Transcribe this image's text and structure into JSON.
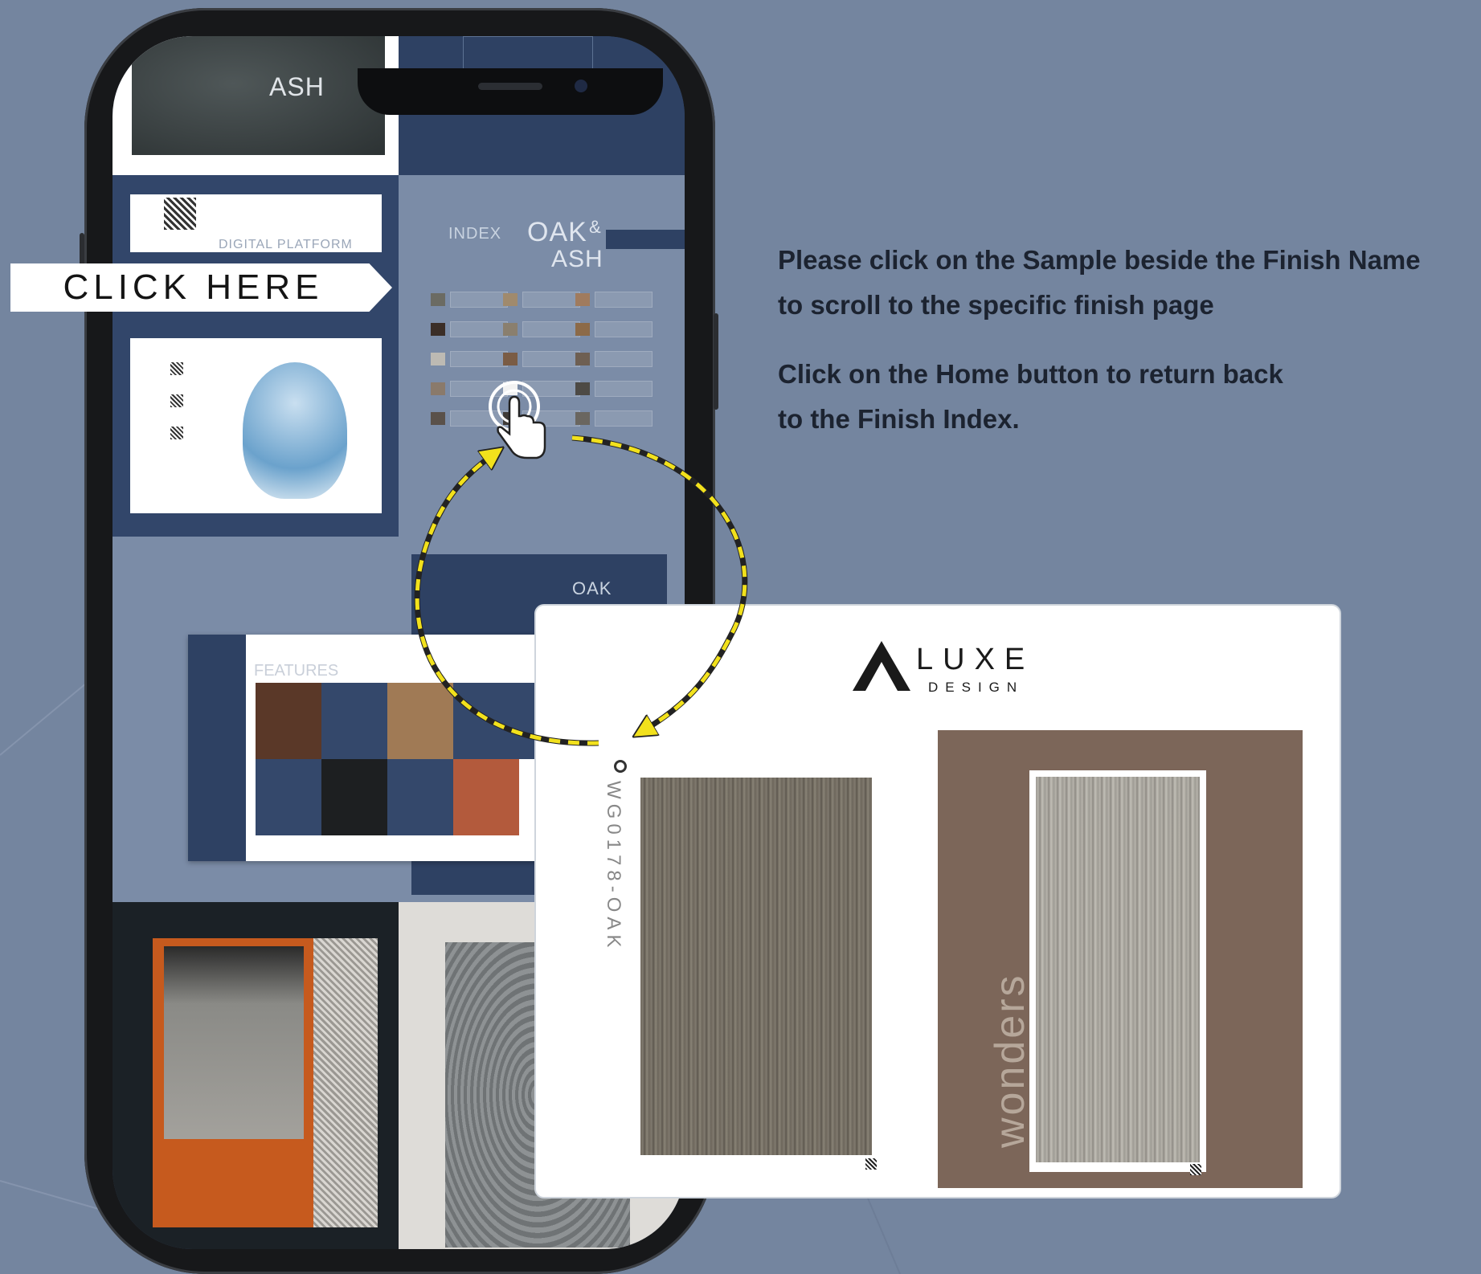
{
  "callout": {
    "label": "CLICK HERE"
  },
  "instructions": {
    "line1": "Please click on the Sample beside the Finish Name",
    "line2": "to scroll to the specific finish page",
    "line3": "Click on the Home button to return back",
    "line4": "to the Finish Index."
  },
  "phone_pages": {
    "ash_label": "ASH",
    "digital_platform": "DIGITAL PLATFORM",
    "index_label": "INDEX",
    "oak_label": "OAK",
    "amp": "&",
    "ash2_label": "ASH",
    "features_label": "FEATURES",
    "oak_small": "OAK"
  },
  "card": {
    "brand_name": "LUXE",
    "brand_sub": "DESIGN",
    "sample_code": "WG0178-OAK",
    "wonders_label": "wonders"
  },
  "colors": {
    "background": "#74859f",
    "highlight_arrow": "#f2e11c",
    "phone_frame": "#17181a",
    "navy": "#2e4163"
  },
  "index_swatches": [
    "#6b6b63",
    "#a08a6d",
    "#a07b5e",
    "#3b2e27",
    "#8a7f6e",
    "#8c6a48",
    "#bdbab3",
    "#7a5c45",
    "#6e5f52",
    "#8a7a6b",
    "#f2f2f2",
    "#4d4a45",
    "#5a514a",
    "#3f3b37",
    "#6a6660"
  ]
}
